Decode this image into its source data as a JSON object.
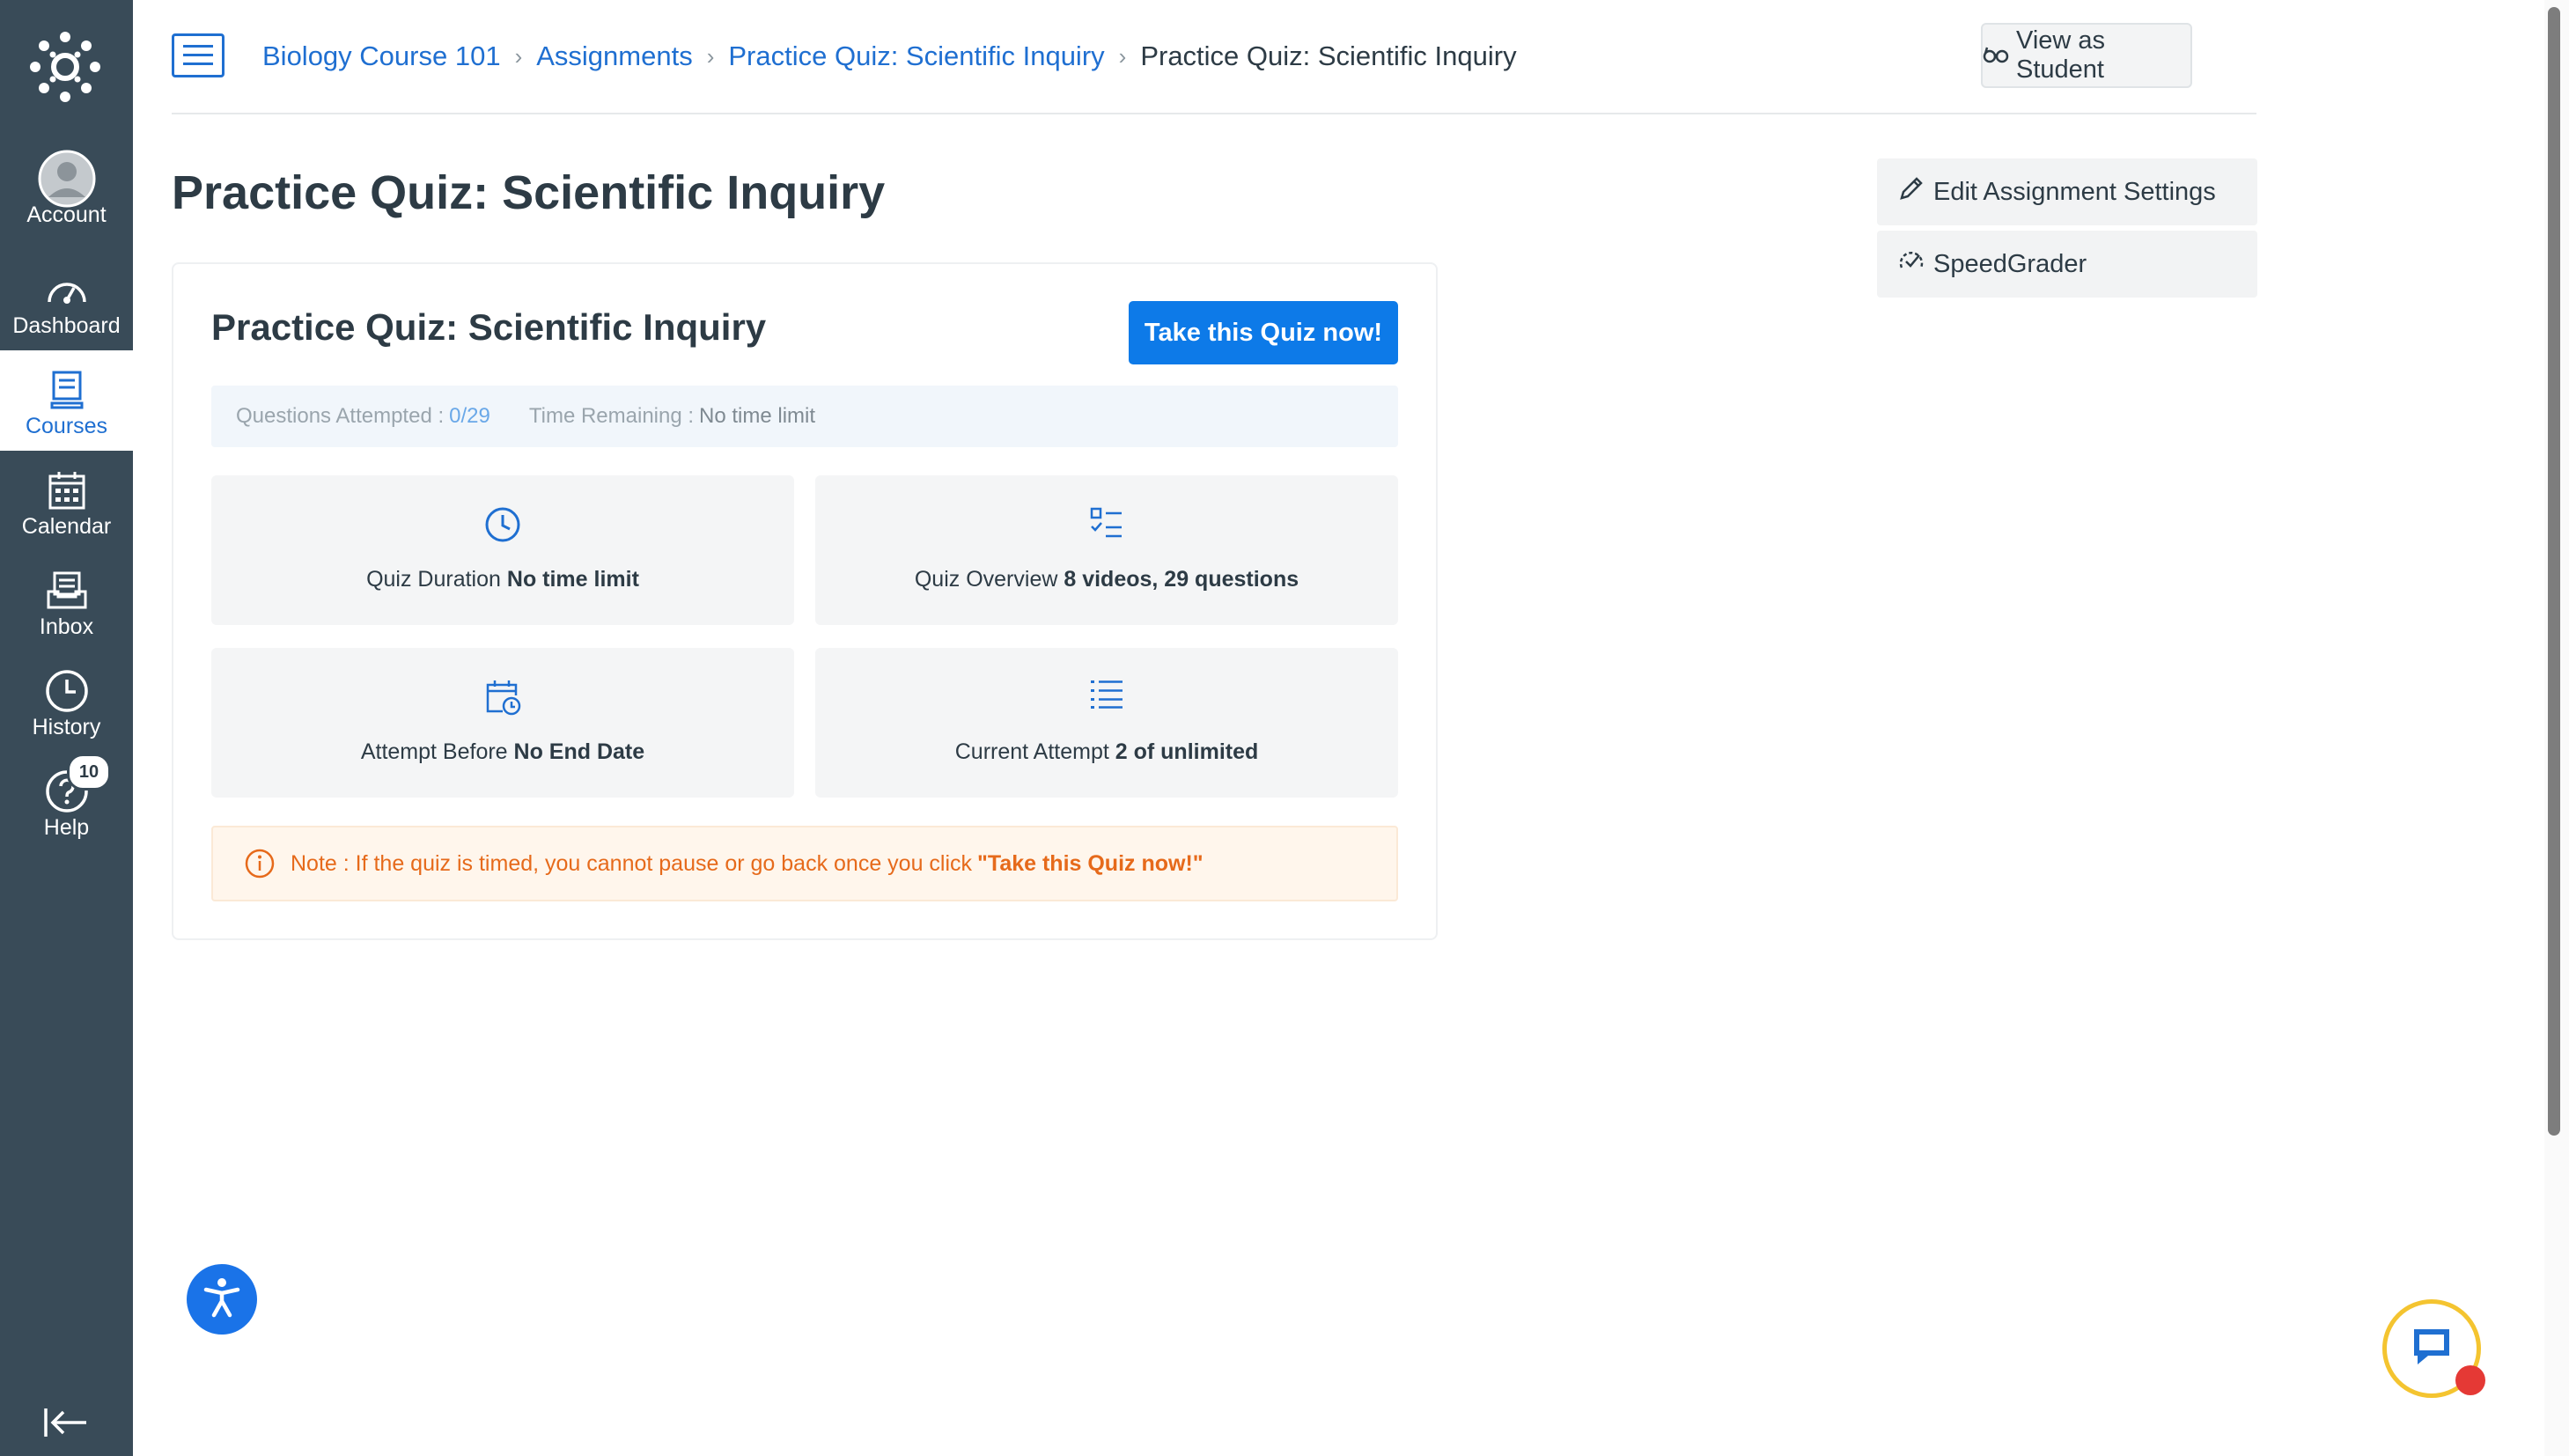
{
  "nav": {
    "items": [
      {
        "label": "Account",
        "icon": "avatar-icon"
      },
      {
        "label": "Dashboard",
        "icon": "dashboard-icon"
      },
      {
        "label": "Courses",
        "icon": "courses-icon"
      },
      {
        "label": "Calendar",
        "icon": "calendar-icon"
      },
      {
        "label": "Inbox",
        "icon": "inbox-icon"
      },
      {
        "label": "History",
        "icon": "history-icon"
      },
      {
        "label": "Help",
        "icon": "help-icon"
      }
    ],
    "help_badge": "10",
    "active": "Courses"
  },
  "breadcrumb": {
    "items": [
      "Biology Course 101",
      "Assignments",
      "Practice Quiz: Scientific Inquiry"
    ],
    "current": "Practice Quiz: Scientific Inquiry"
  },
  "header": {
    "view_as_student": "View as Student"
  },
  "page_title": "Practice Quiz: Scientific Inquiry",
  "sidebar": {
    "edit_settings": "Edit Assignment Settings",
    "speedgrader": "SpeedGrader"
  },
  "quiz": {
    "title": "Practice Quiz: Scientific Inquiry",
    "take_button": "Take this Quiz now!",
    "questions_attempted_label": "Questions Attempted :",
    "questions_attempted_value": "0/29",
    "time_remaining_label": "Time Remaining :",
    "time_remaining_value": "No time limit",
    "tiles": [
      {
        "label": "Quiz Duration",
        "value": "No time limit",
        "icon": "clock-icon"
      },
      {
        "label": "Quiz Overview",
        "value": "8 videos, 29 questions",
        "icon": "checklist-icon"
      },
      {
        "label": "Attempt Before",
        "value": "No End Date",
        "icon": "calendar-clock-icon"
      },
      {
        "label": "Current Attempt",
        "value": "2 of unlimited",
        "icon": "list-icon"
      }
    ],
    "note_text": "Note : If the quiz is timed, you cannot pause or go back once you click",
    "note_emphasis": "\"Take this Quiz now!\""
  },
  "colors": {
    "nav_bg": "#394b58",
    "link": "#1f6fd1",
    "primary_button": "#0d7ae8",
    "note_text": "#e66a1b",
    "note_bg": "#fff6ec"
  }
}
